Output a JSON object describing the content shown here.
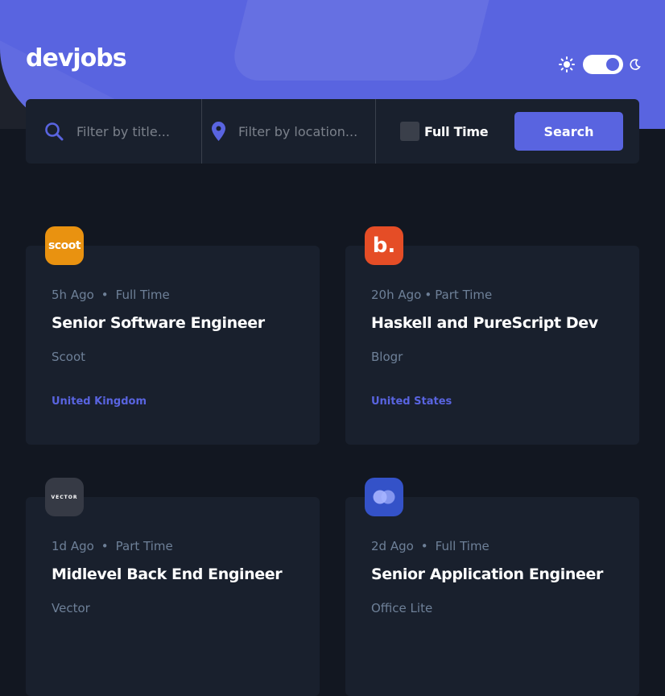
{
  "header": {
    "logo": "devjobs",
    "colors": {
      "accent": "#5964E0",
      "background": "#121721",
      "card": "#19202D"
    },
    "theme_toggle": {
      "state": "dark",
      "icons": [
        "sun-icon",
        "moon-icon"
      ]
    }
  },
  "search": {
    "title_placeholder": "Filter by title...",
    "location_placeholder": "Filter by location...",
    "full_time_label": "Full Time",
    "full_time_checked": false,
    "search_label": "Search"
  },
  "jobs": [
    {
      "posted": "5h Ago",
      "contract": "Full Time",
      "position": "Senior Software Engineer",
      "company": "Scoot",
      "location": "United Kingdom",
      "logo_text": "scoot",
      "logo_color": "#E99210"
    },
    {
      "posted": "20h Ago",
      "contract": "Part Time",
      "position": "Haskell and PureScript Dev",
      "company": "Blogr",
      "location": "United States",
      "logo_text": "b.",
      "logo_color": "#E54D26"
    },
    {
      "posted": "1d Ago",
      "contract": "Part Time",
      "position": "Midlevel Back End Engineer",
      "company": "Vector",
      "location": "",
      "logo_text": "VECTOR",
      "logo_color": "#363F5F"
    },
    {
      "posted": "2d Ago",
      "contract": "Full Time",
      "position": "Senior Application Engineer",
      "company": "Office Lite",
      "location": "",
      "logo_text": "",
      "logo_color": "#4E5FD9"
    }
  ]
}
